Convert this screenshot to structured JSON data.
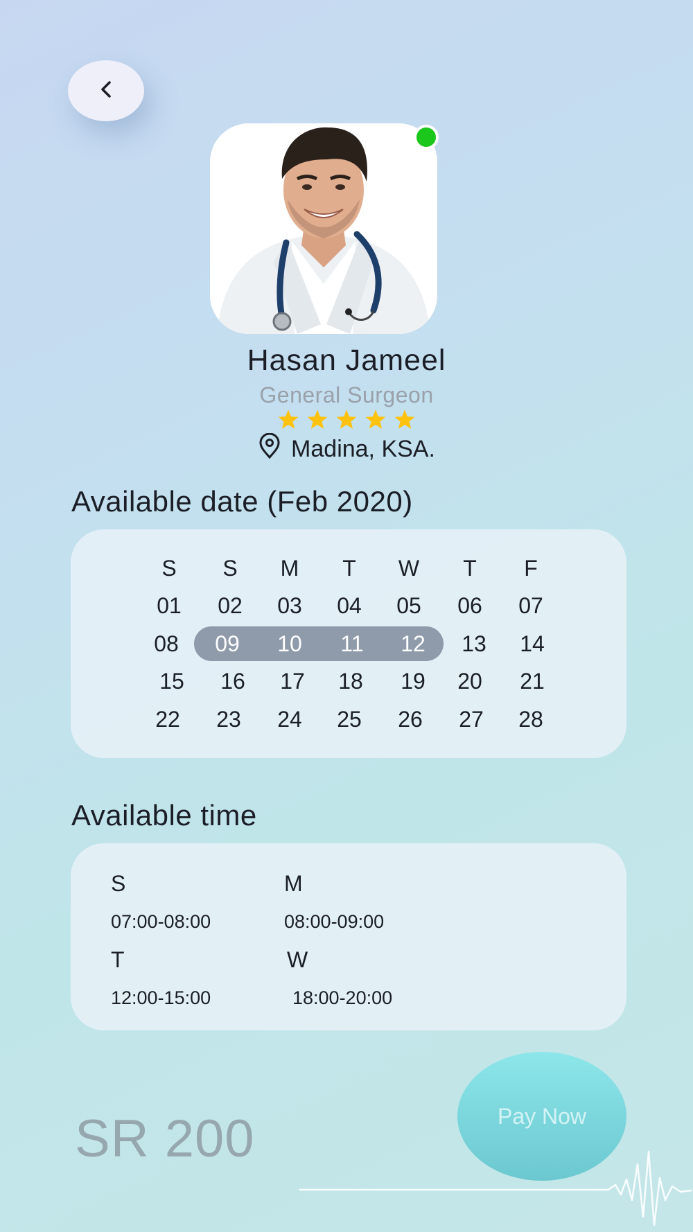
{
  "doctor": {
    "name": "Hasan Jameel",
    "specialty": "General Surgeon",
    "rating": 5,
    "location": "Madina, KSA.",
    "online": true,
    "status_color": "#1cc71c"
  },
  "icons": {
    "back": "chevron-left-icon",
    "location": "location-pin-icon",
    "star": "star-icon"
  },
  "calendar": {
    "title": "Available date (Feb 2020)",
    "weekdays": [
      "S",
      "S",
      "M",
      "T",
      "W",
      "T",
      "F"
    ],
    "weeks": [
      [
        "01",
        "02",
        "03",
        "04",
        "05",
        "06",
        "07"
      ],
      [
        "08",
        "09",
        "10",
        "11",
        "12",
        "13",
        "14"
      ],
      [
        "15",
        "16",
        "17",
        "18",
        "19",
        "20",
        "21"
      ],
      [
        "22",
        "23",
        "24",
        "25",
        "26",
        "27",
        "28"
      ]
    ],
    "selected": [
      "09",
      "10",
      "11",
      "12"
    ]
  },
  "times": {
    "title": "Available time",
    "slots": [
      {
        "day": "S",
        "range": "07:00-08:00"
      },
      {
        "day": "M",
        "range": "08:00-09:00"
      },
      {
        "day": "T",
        "range": "12:00-15:00"
      },
      {
        "day": "W",
        "range": "18:00-20:00"
      }
    ]
  },
  "payment": {
    "price": "SR 200",
    "button_label": "Pay Now"
  },
  "colors": {
    "star": "#ffc20e",
    "selection": "#8f9aab",
    "pay_button": "#7dd9df",
    "price_text": "#97a7ae"
  }
}
